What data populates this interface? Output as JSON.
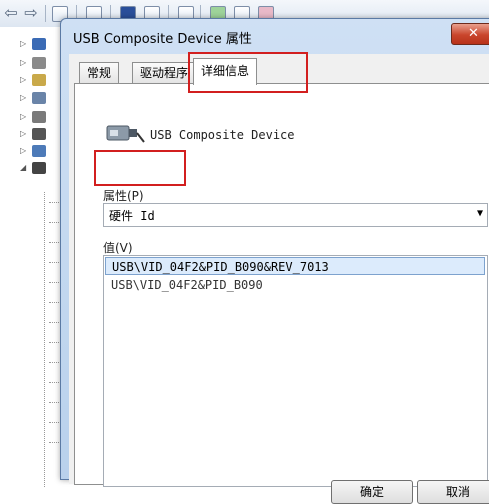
{
  "dialog": {
    "title": "USB Composite Device 属性",
    "close_glyph": "✕"
  },
  "tabs": [
    {
      "label": "常规"
    },
    {
      "label": "驱动程序"
    },
    {
      "label": "详细信息",
      "active": true
    }
  ],
  "device": {
    "name": "USB Composite Device",
    "icon": "usb-connector-icon"
  },
  "property": {
    "label": "属性(P)",
    "selected": "硬件 Id"
  },
  "value": {
    "label": "值(V)",
    "items": [
      "USB\\VID_04F2&PID_B090&REV_7013",
      "USB\\VID_04F2&PID_B090"
    ],
    "selected_index": 0
  },
  "buttons": {
    "ok": "确定",
    "cancel": "取消"
  },
  "colors": {
    "highlight": "#d21f1f",
    "selection": "#dcebfc",
    "title_bar": "#b9d1ec"
  }
}
